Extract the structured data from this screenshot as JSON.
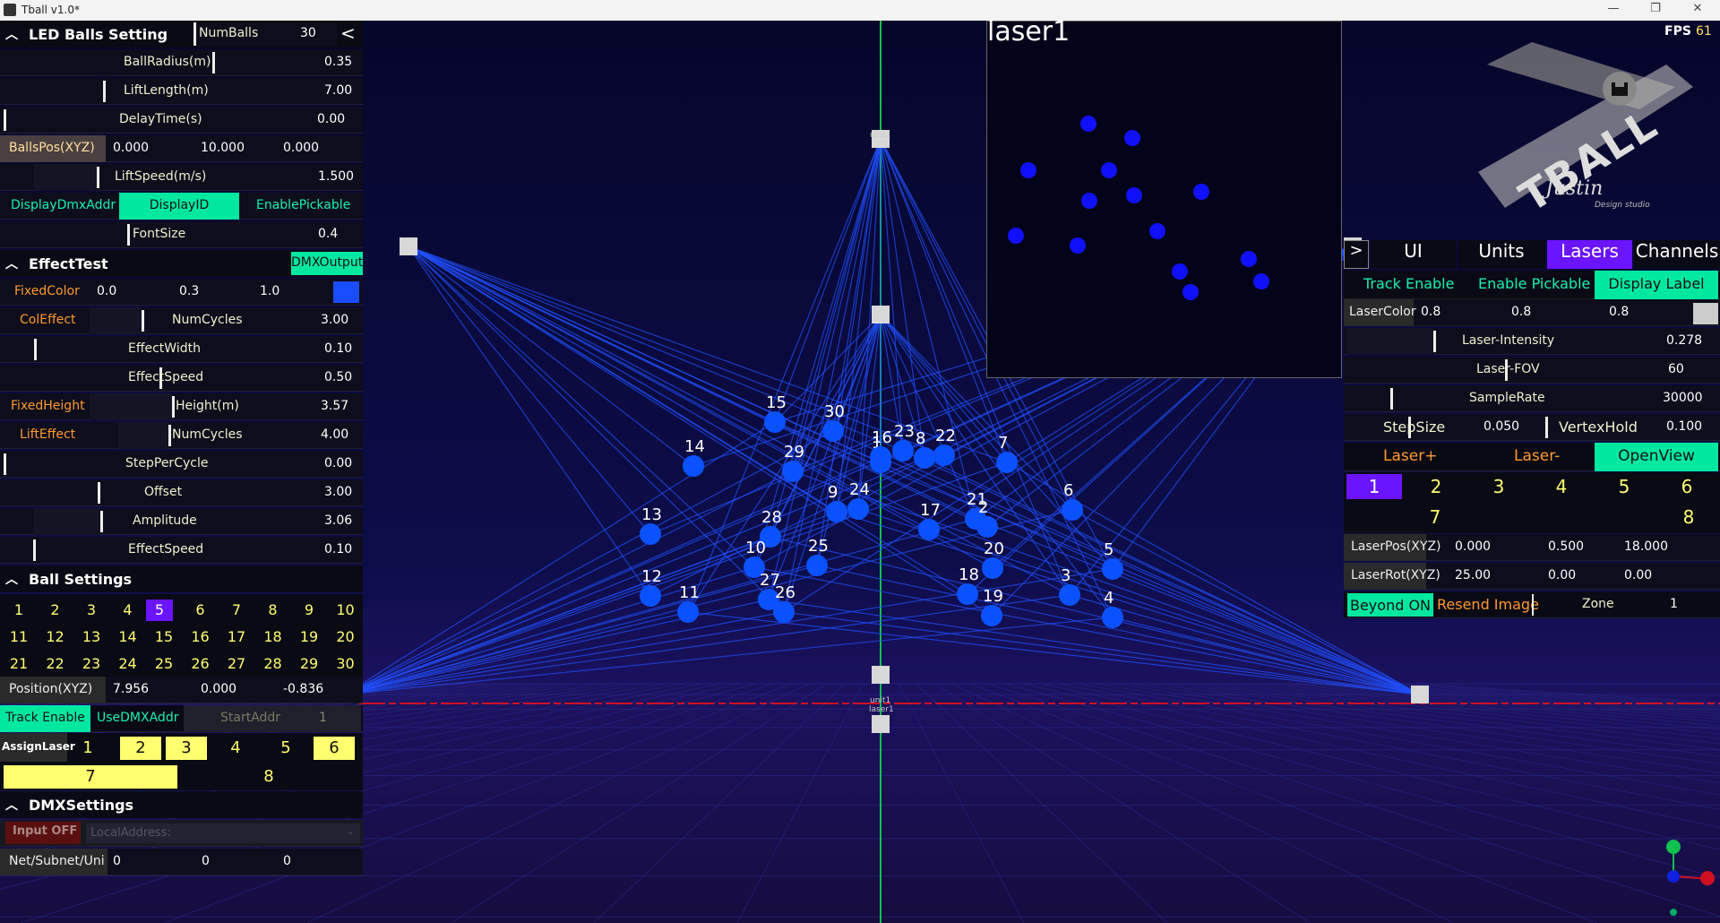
{
  "window": {
    "title": "Tball v1.0*",
    "min": "—",
    "max": "❐",
    "close": "✕"
  },
  "left": {
    "led_header": "LED Balls Setting",
    "numballs_label": "NumBalls",
    "numballs_value": "30",
    "collapse_btn": "<",
    "ball_radius": {
      "label": "BallRadius(m)",
      "value": "0.35"
    },
    "lift_length": {
      "label": "LiftLength(m)",
      "value": "7.00"
    },
    "delay_time": {
      "label": "DelayTime(s)",
      "value": "0.00"
    },
    "balls_pos": {
      "label": "BallsPos(XYZ)",
      "x": "0.000",
      "y": "10.000",
      "z": "0.000"
    },
    "lift_speed": {
      "label": "LiftSpeed(m/s)",
      "value": "1.500"
    },
    "display_dmx": "DisplayDmxAddr",
    "display_id": "DisplayID",
    "enable_pickable": "EnablePickable",
    "font_size": {
      "label": "FontSize",
      "value": "0.4"
    },
    "effect_header": "EffectTest",
    "dmx_output": "DMXOutput",
    "fixed_color": {
      "label": "FixedColor",
      "r": "0.0",
      "g": "0.3",
      "b": "1.0",
      "swatch": "#1a4cff"
    },
    "col_effect": {
      "label": "ColEffect",
      "sub": "NumCycles",
      "value": "3.00"
    },
    "effect_width": {
      "label": "EffectWidth",
      "value": "0.10"
    },
    "effect_speed": {
      "label": "EffectSpeed",
      "value": "0.50"
    },
    "fixed_height": {
      "label": "FixedHeight",
      "sub": "Height(m)",
      "value": "3.57"
    },
    "lift_effect": {
      "label": "LiftEffect",
      "sub": "NumCycles",
      "value": "4.00"
    },
    "step_per_cycle": {
      "label": "StepPerCycle",
      "value": "0.00"
    },
    "offset": {
      "label": "Offset",
      "value": "3.00"
    },
    "amplitude": {
      "label": "Amplitude",
      "value": "3.06"
    },
    "effect_speed2": {
      "label": "EffectSpeed",
      "value": "0.10"
    },
    "ball_settings_header": "Ball Settings",
    "balls": [
      "1",
      "2",
      "3",
      "4",
      "5",
      "6",
      "7",
      "8",
      "9",
      "10",
      "11",
      "12",
      "13",
      "14",
      "15",
      "16",
      "17",
      "18",
      "19",
      "20",
      "21",
      "22",
      "23",
      "24",
      "25",
      "26",
      "27",
      "28",
      "29",
      "30"
    ],
    "selected_ball": "5",
    "position": {
      "label": "Position(XYZ)",
      "x": "7.956",
      "y": "0.000",
      "z": "-0.836"
    },
    "track_enable": "Track Enable",
    "use_dmx": "UseDMXAddr",
    "start_addr": "StartAddr",
    "start_addr_value": "1",
    "assign_laser": "AssignLaser",
    "lasers": [
      "1",
      "2",
      "3",
      "4",
      "5",
      "6",
      "7",
      "8"
    ],
    "dmx_header": "DMXSettings",
    "input_off": "Input OFF",
    "local_address": "LocalAddress:",
    "net_subnet": {
      "label": "Net/Subnet/Uni",
      "a": "0",
      "b": "0",
      "c": "0"
    }
  },
  "preview": {
    "title": "laser1"
  },
  "right": {
    "fps_label": "FPS",
    "fps_value": "61",
    "logo_text": "TBALL",
    "logo_sign": "Justin",
    "logo_sub": "Design studio",
    "tab_arrow": ">",
    "tabs": [
      "UI",
      "Units",
      "Lasers",
      "Channels"
    ],
    "track_enable": "Track Enable",
    "enable_pickable": "Enable Pickable",
    "display_label": "Display Label",
    "laser_color": {
      "label": "LaserColor",
      "r": "0.8",
      "g": "0.8",
      "b": "0.8",
      "swatch": "#cccccc"
    },
    "laser_intensity": {
      "label": "Laser-Intensity",
      "value": "0.278"
    },
    "laser_fov": {
      "label": "Laser-FOV",
      "value": "60"
    },
    "sample_rate": {
      "label": "SampleRate",
      "value": "30000"
    },
    "step_size": {
      "label": "StepSize",
      "value": "0.050"
    },
    "vertex_hold": {
      "label": "VertexHold",
      "value": "0.100"
    },
    "laser_plus": "Laser+",
    "laser_minus": "Laser-",
    "open_view": "OpenView",
    "laser_ids": [
      "1",
      "2",
      "3",
      "4",
      "5",
      "6",
      "7",
      "8"
    ],
    "laser_pos": {
      "label": "LaserPos(XYZ)",
      "x": "0.000",
      "y": "0.500",
      "z": "18.000"
    },
    "laser_rot": {
      "label": "LaserRot(XYZ)",
      "x": "25.00",
      "y": "0.00",
      "z": "0.00"
    },
    "beyond_on": "Beyond ON",
    "resend": "Resend Image",
    "zone_label": "Zone",
    "zone_value": "1"
  },
  "scene": {
    "unit_top": "unit1",
    "unit_bottom": "unit1",
    "laser_bottom": "laser1",
    "ball_labels": [
      "15",
      "30",
      "14",
      "29",
      "1",
      "16",
      "23",
      "8",
      "22",
      "7",
      "13",
      "28",
      "9",
      "24",
      "17",
      "21",
      "2",
      "6",
      "10",
      "25",
      "20",
      "5",
      "12",
      "27",
      "26",
      "11",
      "18",
      "3",
      "19",
      "4"
    ]
  },
  "colors": {
    "cyan": "#00e8a0",
    "purple": "#6a14ff",
    "yellow": "#ffff70",
    "orange": "#ff9a2e",
    "ball": "#0a52ff"
  }
}
